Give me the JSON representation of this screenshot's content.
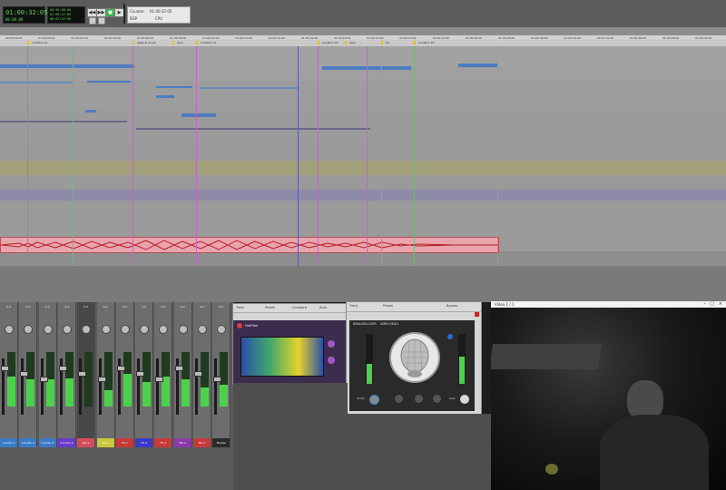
{
  "transport": {
    "main_counter": "01:00:32:05",
    "sub_counter": "00:00:00",
    "start": "00:58:00:00",
    "end": "01:05:47:09",
    "length": "00:07:47:09",
    "counter_label": "Counter",
    "counter_value": "01:00:32:05",
    "dsp_label": "DSP",
    "cpu_label": "CPU",
    "buttons": [
      "◀◀",
      "▶▶",
      "■",
      "▶",
      "●"
    ]
  },
  "ruler": {
    "timecodes": [
      "00:59:58:00",
      "01:00:00:00",
      "01:00:02:00",
      "01:00:04:00",
      "01:00:06:00",
      "01:00:08:00",
      "01:00:10:00",
      "01:00:12:00",
      "01:00:14:00",
      "01:00:16:00",
      "01:00:18:00",
      "01:00:20:00",
      "01:00:22:00",
      "01:00:24:00",
      "01:00:26:00",
      "01:00:28:00",
      "01:00:30:00",
      "01:00:32:00",
      "01:00:34:00",
      "01:00:36:00",
      "01:00:38:00",
      "01:00:40:00"
    ]
  },
  "markers": [
    {
      "label": "Location 11"
    },
    {
      "label": "glass & mood"
    },
    {
      "label": "door"
    },
    {
      "label": "Location 11"
    },
    {
      "label": "Location 16"
    },
    {
      "label": "stop"
    },
    {
      "label": "hit"
    },
    {
      "label": "Location 18"
    }
  ],
  "mixer": {
    "strips": [
      {
        "name": "1-Audio 1",
        "vol": "0.0"
      },
      {
        "name": "2-Audio 2",
        "vol": "0.0"
      },
      {
        "name": "3-Audio 3",
        "vol": "0.0"
      },
      {
        "name": "4-Audio 4",
        "vol": "-2.4"
      },
      {
        "name": "DIA 1",
        "vol": "0.0"
      },
      {
        "name": "DIA 2",
        "vol": "0.0"
      },
      {
        "name": "FX 1",
        "vol": "0.0"
      },
      {
        "name": "FX 2",
        "vol": "0.0"
      },
      {
        "name": "FX 3",
        "vol": "0.0"
      },
      {
        "name": "MX 1",
        "vol": "0.0"
      },
      {
        "name": "MX 2",
        "vol": "0.0"
      },
      {
        "name": "Master",
        "vol": "0.0"
      }
    ]
  },
  "plugins": {
    "eq": {
      "track_label": "Track",
      "preset_label": "Preset",
      "compare_label": "Compare",
      "auto_label": "Auto",
      "bypass_label": "Bypass",
      "brand": "FabFilter"
    },
    "binaural": {
      "track_label": "Track",
      "preset_label": "Preset",
      "title": "AMBI HEAD",
      "sub": "BINAURALIZER",
      "bypass_label": "Bypass",
      "width_label": "Width",
      "gain_label": "Gain"
    }
  },
  "video": {
    "title": "Video 1 / 1"
  }
}
